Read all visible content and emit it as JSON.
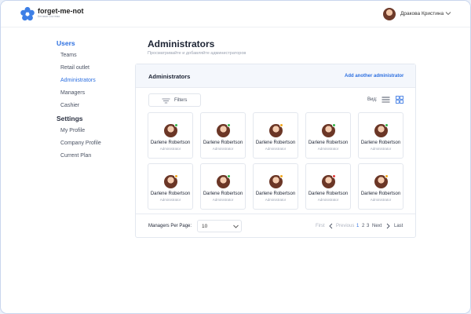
{
  "header": {
    "brand": "forget-me-not",
    "brand_sub": "Беговая Система",
    "user_name": "Дракова Кристина"
  },
  "sidebar": {
    "groups": [
      {
        "label": "Users",
        "active": true,
        "items": [
          {
            "label": "Teams",
            "active": false
          },
          {
            "label": "Retail outlet",
            "active": false
          },
          {
            "label": "Administrators",
            "active": true
          },
          {
            "label": "Managers",
            "active": false
          },
          {
            "label": "Cashier",
            "active": false
          }
        ]
      },
      {
        "label": "Settings",
        "active": false,
        "items": [
          {
            "label": "My Profile",
            "active": false
          },
          {
            "label": "Company Profile",
            "active": false
          },
          {
            "label": "Current Plan",
            "active": false
          }
        ]
      }
    ]
  },
  "main": {
    "title": "Administrators",
    "subtitle": "Просматривайте и добавляйте администраторов",
    "panel": {
      "title": "Administrators",
      "add_label": "Add another administrator",
      "filters_label": "Filters",
      "view_label": "Вид:",
      "view_mode": "grid",
      "cards": [
        {
          "name": "Darlene Robertson",
          "role": "Administrator",
          "status_color": "#33b44a"
        },
        {
          "name": "Darlene Robertson",
          "role": "Administrator",
          "status_color": "#33b44a"
        },
        {
          "name": "Darlene Robertson",
          "role": "Administrator",
          "status_color": "#f2a81d"
        },
        {
          "name": "Darlene Robertson",
          "role": "Administrator",
          "status_color": "#33b44a"
        },
        {
          "name": "Darlene Robertson",
          "role": "Administrator",
          "status_color": "#33b44a"
        },
        {
          "name": "Darlene Robertson",
          "role": "Administrator",
          "status_color": "#f2a81d"
        },
        {
          "name": "Darlene Robertson",
          "role": "Administrator",
          "status_color": "#33b44a"
        },
        {
          "name": "Darlene Robertson",
          "role": "Administrator",
          "status_color": "#f2a81d"
        },
        {
          "name": "Darlene Robertson",
          "role": "Administrator",
          "status_color": "#e23b3b"
        },
        {
          "name": "Darlene Robertson",
          "role": "Administrator",
          "status_color": "#f2a81d"
        }
      ]
    },
    "footer": {
      "per_page_label": "Managers Per Page:",
      "per_page_value": "10",
      "first_label": "First",
      "previous_label": "Previous",
      "pages": [
        "1",
        "2",
        "3"
      ],
      "current_page": "1",
      "next_label": "Next",
      "last_label": "Last"
    }
  },
  "colors": {
    "accent": "#2c6fe0",
    "status_online": "#33b44a",
    "status_away": "#f2a81d",
    "status_busy": "#e23b3b"
  },
  "icons": [
    "flower-logo-icon",
    "chevron-down-icon",
    "filter-icon",
    "list-view-icon",
    "grid-view-icon",
    "chevron-left-icon",
    "chevron-right-icon"
  ]
}
